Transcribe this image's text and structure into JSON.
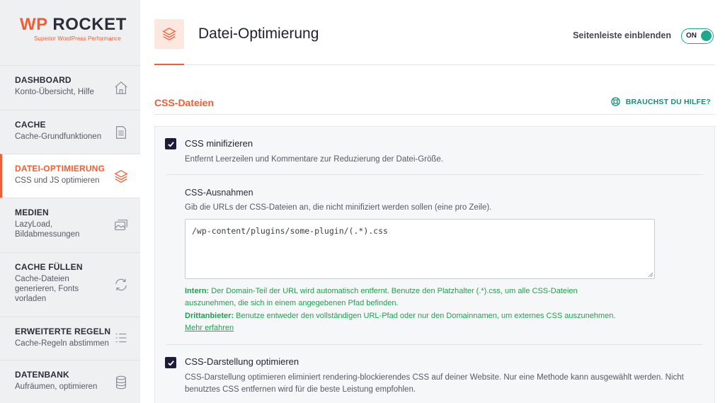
{
  "brand": {
    "logo_wp": "WP",
    "logo_rest": "ROCKET",
    "tagline": "Superior WordPress Performance"
  },
  "sidebar": {
    "items": [
      {
        "title": "DASHBOARD",
        "desc": "Konto-Übersicht, Hilfe",
        "icon": "home-icon"
      },
      {
        "title": "CACHE",
        "desc": "Cache-Grundfunktionen",
        "icon": "document-icon"
      },
      {
        "title": "DATEI-OPTIMIERUNG",
        "desc": "CSS und JS optimieren",
        "icon": "layers-icon",
        "active": true
      },
      {
        "title": "MEDIEN",
        "desc": "LazyLoad, Bildabmessungen",
        "icon": "images-icon"
      },
      {
        "title": "CACHE FÜLLEN",
        "desc": "Cache-Dateien generieren, Fonts vorladen",
        "icon": "refresh-icon"
      },
      {
        "title": "ERWEITERTE REGELN",
        "desc": "Cache-Regeln abstimmen",
        "icon": "list-icon"
      },
      {
        "title": "DATENBANK",
        "desc": "Aufräumen, optimieren",
        "icon": "database-icon"
      }
    ]
  },
  "header": {
    "title": "Datei-Optimierung",
    "sidebar_toggle_label": "Seitenleiste einblenden",
    "toggle_state": "ON"
  },
  "section": {
    "title": "CSS-Dateien",
    "help_label": "BRAUCHST DU HILFE?"
  },
  "options": {
    "minify": {
      "label": "CSS minifizieren",
      "checked": true,
      "desc": "Entfernt Leerzeilen und Kommentare zur Reduzierung der Datei-Größe."
    },
    "exclusions": {
      "title": "CSS-Ausnahmen",
      "desc": "Gib die URLs der CSS-Dateien an, die nicht minifiziert werden sollen (eine pro Zeile).",
      "value": "/wp-content/plugins/some-plugin/(.*).css",
      "note_intern_label": "Intern:",
      "note_intern_line1": " Der Domain-Teil der URL wird automatisch entfernt. Benutze den Platzhalter (.*).css, um alle CSS-Dateien",
      "note_intern_line2": "auszunehmen, die sich in einem angegebenen Pfad befinden.",
      "note_third_label": "Drittanbieter:",
      "note_third_text": " Benutze entweder den vollständigen URL-Pfad oder nur den Domainnamen, um externes CSS auszunehmen.",
      "more_link": "Mehr erfahren"
    },
    "optimize_delivery": {
      "label": "CSS-Darstellung optimieren",
      "checked": true,
      "desc_line1": "CSS-Darstellung optimieren eliminiert rendering-blockierendes CSS auf deiner Website. Nur eine Methode kann ausgewählt werden. Nicht",
      "desc_line2": "benutztes CSS entfernen wird für die beste Leistung empfohlen."
    }
  },
  "colors": {
    "accent": "#f25d35",
    "teal": "#1fa88e",
    "green_note": "#1fa150",
    "checkbox": "#1e1b3a"
  }
}
